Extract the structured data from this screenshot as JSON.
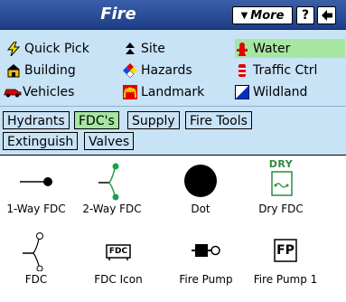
{
  "header": {
    "title": "Fire",
    "more_label": "More",
    "help_label": "?"
  },
  "categories": [
    {
      "label": "Quick Pick",
      "icon": "lightning-icon"
    },
    {
      "label": "Site",
      "icon": "site-icon"
    },
    {
      "label": "Water",
      "icon": "hydrant-icon",
      "selected": true
    },
    {
      "label": "Building",
      "icon": "building-icon"
    },
    {
      "label": "Hazards",
      "icon": "hazard-diamond-icon"
    },
    {
      "label": "Traffic Ctrl",
      "icon": "traffic-barrel-icon"
    },
    {
      "label": "Vehicles",
      "icon": "vehicle-icon"
    },
    {
      "label": "Landmark",
      "icon": "landmark-icon"
    },
    {
      "label": "Wildland",
      "icon": "wildland-icon"
    }
  ],
  "subtabs": [
    {
      "label": "Hydrants"
    },
    {
      "label": "FDC's",
      "active": true
    },
    {
      "label": "Supply"
    },
    {
      "label": "Fire Tools"
    },
    {
      "label": "Extinguish"
    },
    {
      "label": "Valves"
    }
  ],
  "items": [
    {
      "label": "1-Way FDC",
      "icon": "one-way-fdc-icon"
    },
    {
      "label": "2-Way FDC",
      "icon": "two-way-fdc-icon"
    },
    {
      "label": "Dot",
      "icon": "dot-icon"
    },
    {
      "label": "Dry FDC",
      "icon": "dry-fdc-icon",
      "badge": "DRY"
    },
    {
      "label": "FDC",
      "icon": "fdc-icon"
    },
    {
      "label": "FDC Icon",
      "icon": "fdc-box-icon",
      "badge": "FDC"
    },
    {
      "label": "Fire Pump",
      "icon": "fire-pump-icon"
    },
    {
      "label": "Fire Pump 1",
      "icon": "fire-pump-1-icon",
      "badge": "FP"
    }
  ],
  "colors": {
    "titlebar": "#1e3f86",
    "panel_bg": "#c8e2f6",
    "selected_bg": "#a6e6a2",
    "dry_green": "#2e8b3e"
  }
}
